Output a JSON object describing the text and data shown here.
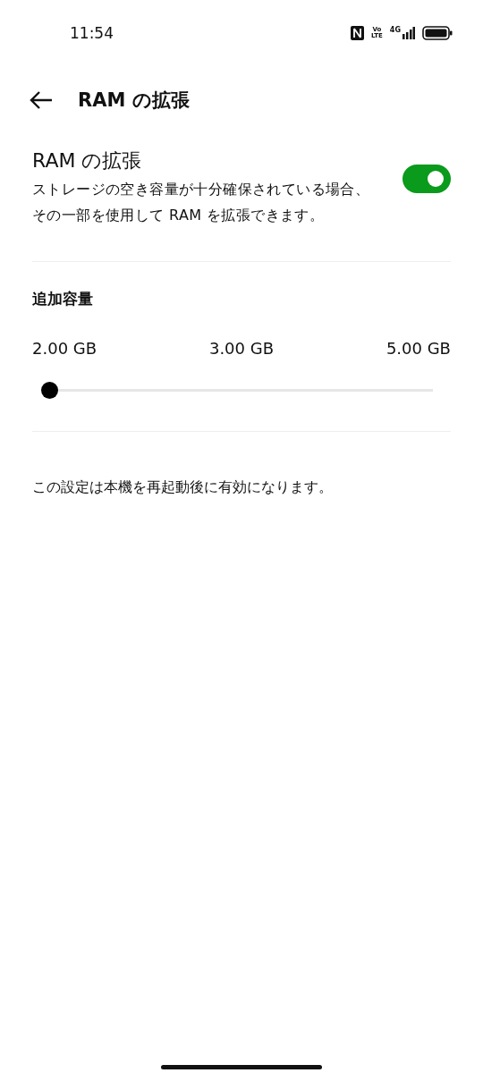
{
  "status_bar": {
    "time": "11:54",
    "volte": [
      "Vo",
      "LTE"
    ],
    "network": "4G"
  },
  "header": {
    "title": "RAM の拡張"
  },
  "setting": {
    "title": "RAM の拡張",
    "description": "ストレージの空き容量が十分確保されている場合、その一部を使用して RAM を拡張できます。",
    "on": true
  },
  "capacity": {
    "title": "追加容量",
    "labels": [
      "2.00 GB",
      "3.00 GB",
      "5.00 GB"
    ],
    "level": 0
  },
  "note": "この設定は本機を再起動後に有効になります。"
}
